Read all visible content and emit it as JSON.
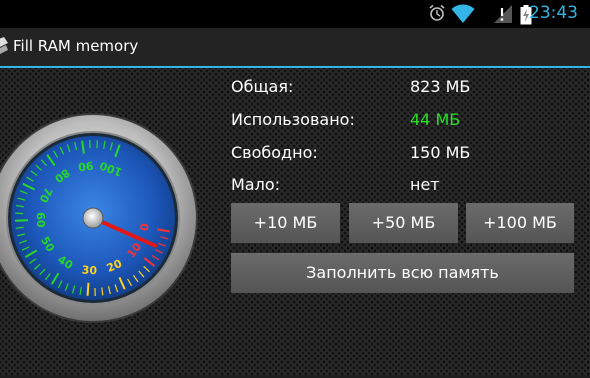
{
  "status_bar": {
    "time": "23:43",
    "icons": [
      "alarm-icon",
      "wifi-icon",
      "no-signal-icon",
      "battery-charging-icon"
    ],
    "accent_color": "#33b5e5"
  },
  "action_bar": {
    "title": "Fill RAM memory",
    "icon": "app-icon"
  },
  "memory": {
    "total_label": "Общая:",
    "total_value": "823 МБ",
    "used_label": "Использовано:",
    "used_value": "44 МБ",
    "used_color": "#28e028",
    "free_label": "Свободно:",
    "free_value": "150 МБ",
    "low_label": "Мало:",
    "low_value": "нет"
  },
  "buttons": {
    "add10": "+10 МБ",
    "add50": "+50 МБ",
    "add100": "+100 МБ",
    "fill_all": "Заполнить всю память"
  },
  "gauge": {
    "ticks": [
      "0",
      "10",
      "20",
      "30",
      "40",
      "50",
      "60",
      "70",
      "80",
      "90",
      "100"
    ],
    "reading": 5,
    "max": 100
  }
}
